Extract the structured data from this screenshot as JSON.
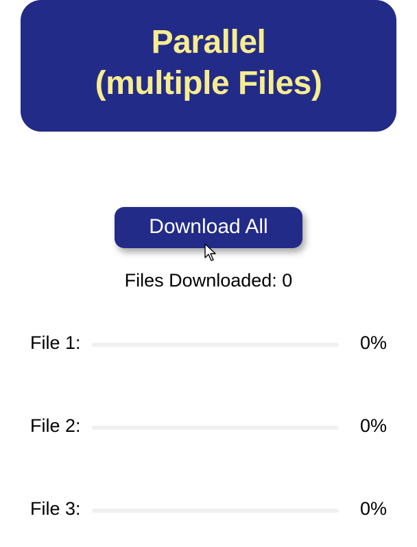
{
  "header": {
    "title_line1": "Parallel",
    "title_line2": "(multiple Files)"
  },
  "actions": {
    "download_all_label": "Download All"
  },
  "status": {
    "files_downloaded_label": "Files Downloaded: ",
    "files_downloaded_count": "0"
  },
  "files": [
    {
      "label": "File 1:",
      "percent": "0%",
      "progress": 0
    },
    {
      "label": "File 2:",
      "percent": "0%",
      "progress": 0
    },
    {
      "label": "File 3:",
      "percent": "0%",
      "progress": 0
    }
  ],
  "colors": {
    "header_bg": "#232b88",
    "header_text": "#f7ed8f",
    "button_bg": "#232b88",
    "button_text": "#ffffff",
    "track": "#eff0ef"
  }
}
